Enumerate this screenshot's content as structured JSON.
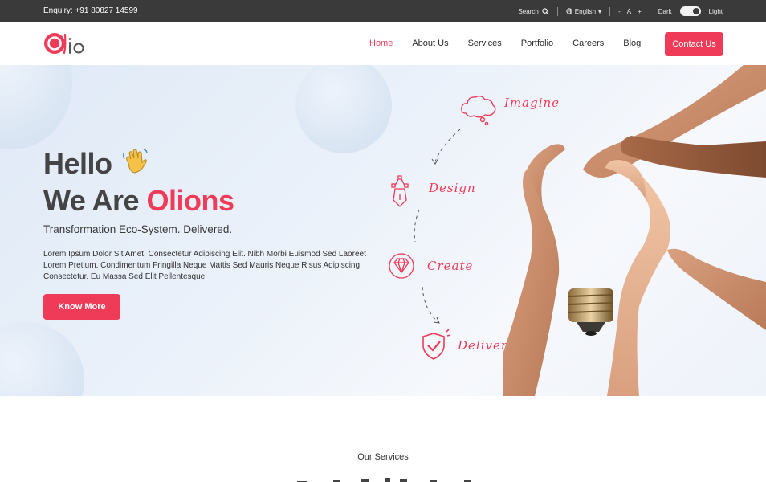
{
  "topbar": {
    "enquiry": "Enquiry: +91 80827 14599",
    "search_label": "Search",
    "language": "English",
    "font_decrease": "-",
    "font_default": "A",
    "font_increase": "+",
    "dark_label": "Dark",
    "light_label": "Light",
    "icons": [
      "search-icon",
      "globe-icon",
      "theme-toggle"
    ]
  },
  "nav": {
    "logo_text": "Olio",
    "items": [
      {
        "label": "Home",
        "active": true
      },
      {
        "label": "About Us",
        "active": false
      },
      {
        "label": "Services",
        "active": false
      },
      {
        "label": "Portfolio",
        "active": false
      },
      {
        "label": "Careers",
        "active": false
      },
      {
        "label": "Blog",
        "active": false
      }
    ],
    "contact_button": "Contact Us"
  },
  "hero": {
    "hello": "Hello",
    "we_are": "We Are ",
    "brand": "Olions",
    "tagline": "Transformation Eco-System. Delivered.",
    "description": "Lorem Ipsum Dolor Sit Amet, Consectetur Adipiscing Elit. Nibh Morbi Euismod Sed Laoreet Lorem Pretium. Condimentum Fringilla Neque Mattis Sed Mauris Neque Risus Adipiscing Consectetur. Eu Massa Sed Elit Pellentesque",
    "cta": "Know More",
    "steps": [
      {
        "label": "Imagine",
        "icon": "cloud-icon"
      },
      {
        "label": "Design",
        "icon": "pen-tool-icon"
      },
      {
        "label": "Create",
        "icon": "diamond-icon"
      },
      {
        "label": "Deliver",
        "icon": "shield-check-icon"
      }
    ]
  },
  "services": {
    "label": "Our Services"
  },
  "colors": {
    "accent": "#ef3b57",
    "topbar": "#3a3a3a",
    "heading": "#444444"
  }
}
